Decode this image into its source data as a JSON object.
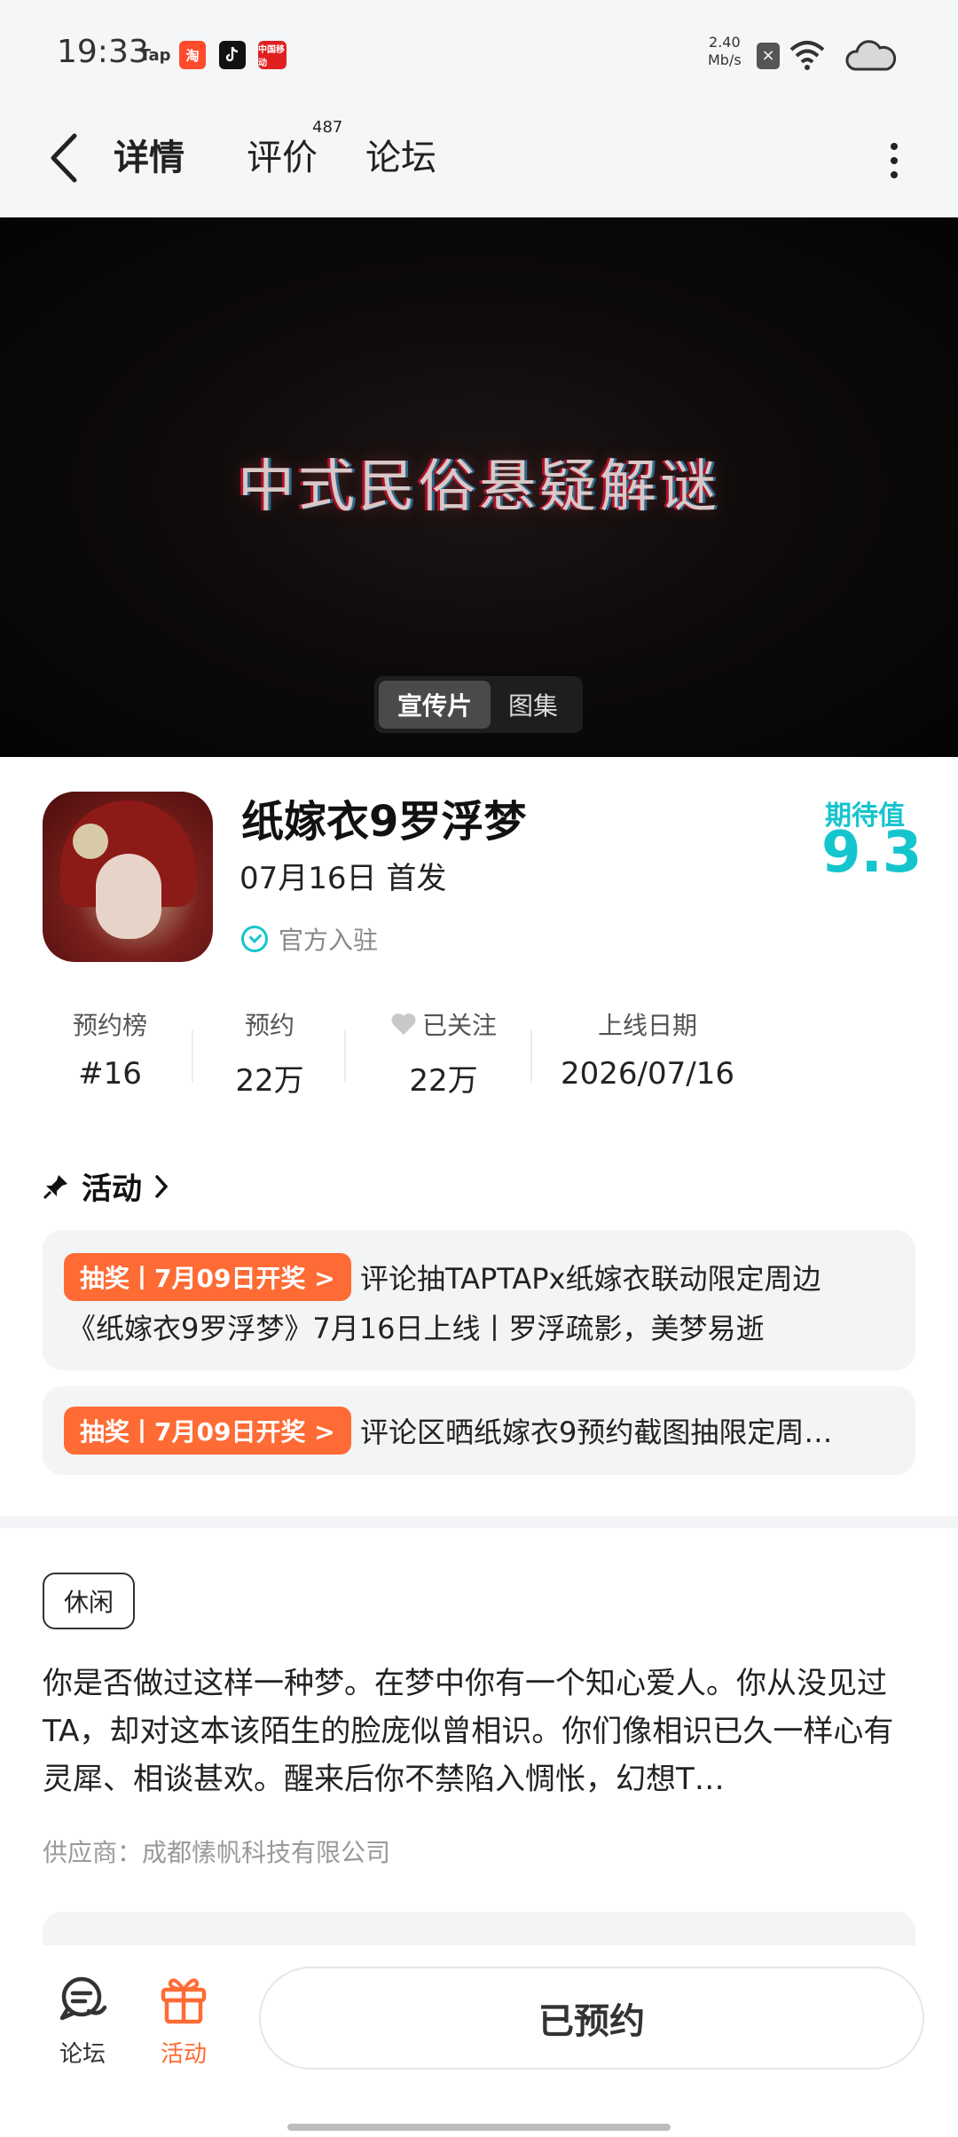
{
  "status_bar": {
    "time": "19:33",
    "apps": [
      "Tap",
      "淘",
      "",
      "中国移动"
    ],
    "net_speed_value": "2.40",
    "net_speed_unit": "Mb/s"
  },
  "nav": {
    "tabs": [
      {
        "label": "详情"
      },
      {
        "label": "评价",
        "count": "487"
      },
      {
        "label": "论坛"
      }
    ]
  },
  "media": {
    "title": "中式民俗悬疑解谜",
    "switch": [
      "宣传片",
      "图集"
    ]
  },
  "app": {
    "name": "纸嫁衣9罗浮梦",
    "release": "07月16日 首发",
    "official": "官方入驻",
    "expect_label": "期待值",
    "expect_score": "9.3"
  },
  "stats": [
    {
      "label": "预约榜",
      "value": "#16"
    },
    {
      "label": "预约",
      "value": "22万"
    },
    {
      "label": "已关注",
      "value": "22万"
    },
    {
      "label": "上线日期",
      "value": "2026/07/16"
    }
  ],
  "activities": {
    "title": "活动",
    "items": [
      {
        "badge": "抽奖丨7月09日开奖 >",
        "line1": "评论抽TAPTAPx纸嫁衣联动限定周边",
        "line2": "《纸嫁衣9罗浮梦》7月16日上线丨罗浮疏影，美梦易逝"
      },
      {
        "badge": "抽奖丨7月09日开奖 >",
        "line1": "评论区晒纸嫁衣9预约截图抽限定周…"
      }
    ]
  },
  "tag": "休闲",
  "description": "你是否做过这样一种梦。在梦中你有一个知心爱人。你从没见过TA，却对这本该陌生的脸庞似曾相识。你们像相识已久一样心有灵犀、相谈甚欢。醒来后你不禁陷入惆怅，幻想T…",
  "supplier": "供应商：成都愫帆科技有限公司",
  "bottom_bar": {
    "forum": "论坛",
    "activity": "活动",
    "reserve_button": "已预约"
  },
  "colors": {
    "accent": "#15c5ce",
    "badge": "#ff6b35"
  }
}
